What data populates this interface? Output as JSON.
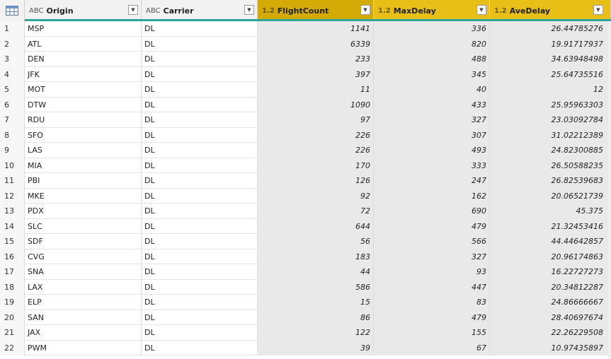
{
  "columns": [
    {
      "type_icon": "ABC",
      "label": "Origin"
    },
    {
      "type_icon": "ABC",
      "label": "Carrier"
    },
    {
      "type_icon": "1.2",
      "label": "FlightCount"
    },
    {
      "type_icon": "1.2",
      "label": "MaxDelay"
    },
    {
      "type_icon": "1.2",
      "label": "AveDelay"
    }
  ],
  "rows": [
    {
      "n": "1",
      "origin": "MSP",
      "carrier": "DL",
      "flights": "1141",
      "max": "336",
      "ave": "26.44785276"
    },
    {
      "n": "2",
      "origin": "ATL",
      "carrier": "DL",
      "flights": "6339",
      "max": "820",
      "ave": "19.91717937"
    },
    {
      "n": "3",
      "origin": "DEN",
      "carrier": "DL",
      "flights": "233",
      "max": "488",
      "ave": "34.63948498"
    },
    {
      "n": "4",
      "origin": "JFK",
      "carrier": "DL",
      "flights": "397",
      "max": "345",
      "ave": "25.64735516"
    },
    {
      "n": "5",
      "origin": "MOT",
      "carrier": "DL",
      "flights": "11",
      "max": "40",
      "ave": "12"
    },
    {
      "n": "6",
      "origin": "DTW",
      "carrier": "DL",
      "flights": "1090",
      "max": "433",
      "ave": "25.95963303"
    },
    {
      "n": "7",
      "origin": "RDU",
      "carrier": "DL",
      "flights": "97",
      "max": "327",
      "ave": "23.03092784"
    },
    {
      "n": "8",
      "origin": "SFO",
      "carrier": "DL",
      "flights": "226",
      "max": "307",
      "ave": "31.02212389"
    },
    {
      "n": "9",
      "origin": "LAS",
      "carrier": "DL",
      "flights": "226",
      "max": "493",
      "ave": "24.82300885"
    },
    {
      "n": "10",
      "origin": "MIA",
      "carrier": "DL",
      "flights": "170",
      "max": "333",
      "ave": "26.50588235"
    },
    {
      "n": "11",
      "origin": "PBI",
      "carrier": "DL",
      "flights": "126",
      "max": "247",
      "ave": "26.82539683"
    },
    {
      "n": "12",
      "origin": "MKE",
      "carrier": "DL",
      "flights": "92",
      "max": "162",
      "ave": "20.06521739"
    },
    {
      "n": "13",
      "origin": "PDX",
      "carrier": "DL",
      "flights": "72",
      "max": "690",
      "ave": "45.375"
    },
    {
      "n": "14",
      "origin": "SLC",
      "carrier": "DL",
      "flights": "644",
      "max": "479",
      "ave": "21.32453416"
    },
    {
      "n": "15",
      "origin": "SDF",
      "carrier": "DL",
      "flights": "56",
      "max": "566",
      "ave": "44.44642857"
    },
    {
      "n": "16",
      "origin": "CVG",
      "carrier": "DL",
      "flights": "183",
      "max": "327",
      "ave": "20.96174863"
    },
    {
      "n": "17",
      "origin": "SNA",
      "carrier": "DL",
      "flights": "44",
      "max": "93",
      "ave": "16.22727273"
    },
    {
      "n": "18",
      "origin": "LAX",
      "carrier": "DL",
      "flights": "586",
      "max": "447",
      "ave": "20.34812287"
    },
    {
      "n": "19",
      "origin": "ELP",
      "carrier": "DL",
      "flights": "15",
      "max": "83",
      "ave": "24.86666667"
    },
    {
      "n": "20",
      "origin": "SAN",
      "carrier": "DL",
      "flights": "86",
      "max": "479",
      "ave": "28.40697674"
    },
    {
      "n": "21",
      "origin": "JAX",
      "carrier": "DL",
      "flights": "122",
      "max": "155",
      "ave": "22.26229508"
    },
    {
      "n": "22",
      "origin": "PWM",
      "carrier": "DL",
      "flights": "39",
      "max": "67",
      "ave": "10.97435897"
    }
  ],
  "colors": {
    "selected_header": "#e8bf17",
    "selected_header_first": "#d4ab06",
    "underline": "#2ea39a",
    "selected_cells": "#e9e9e9"
  }
}
